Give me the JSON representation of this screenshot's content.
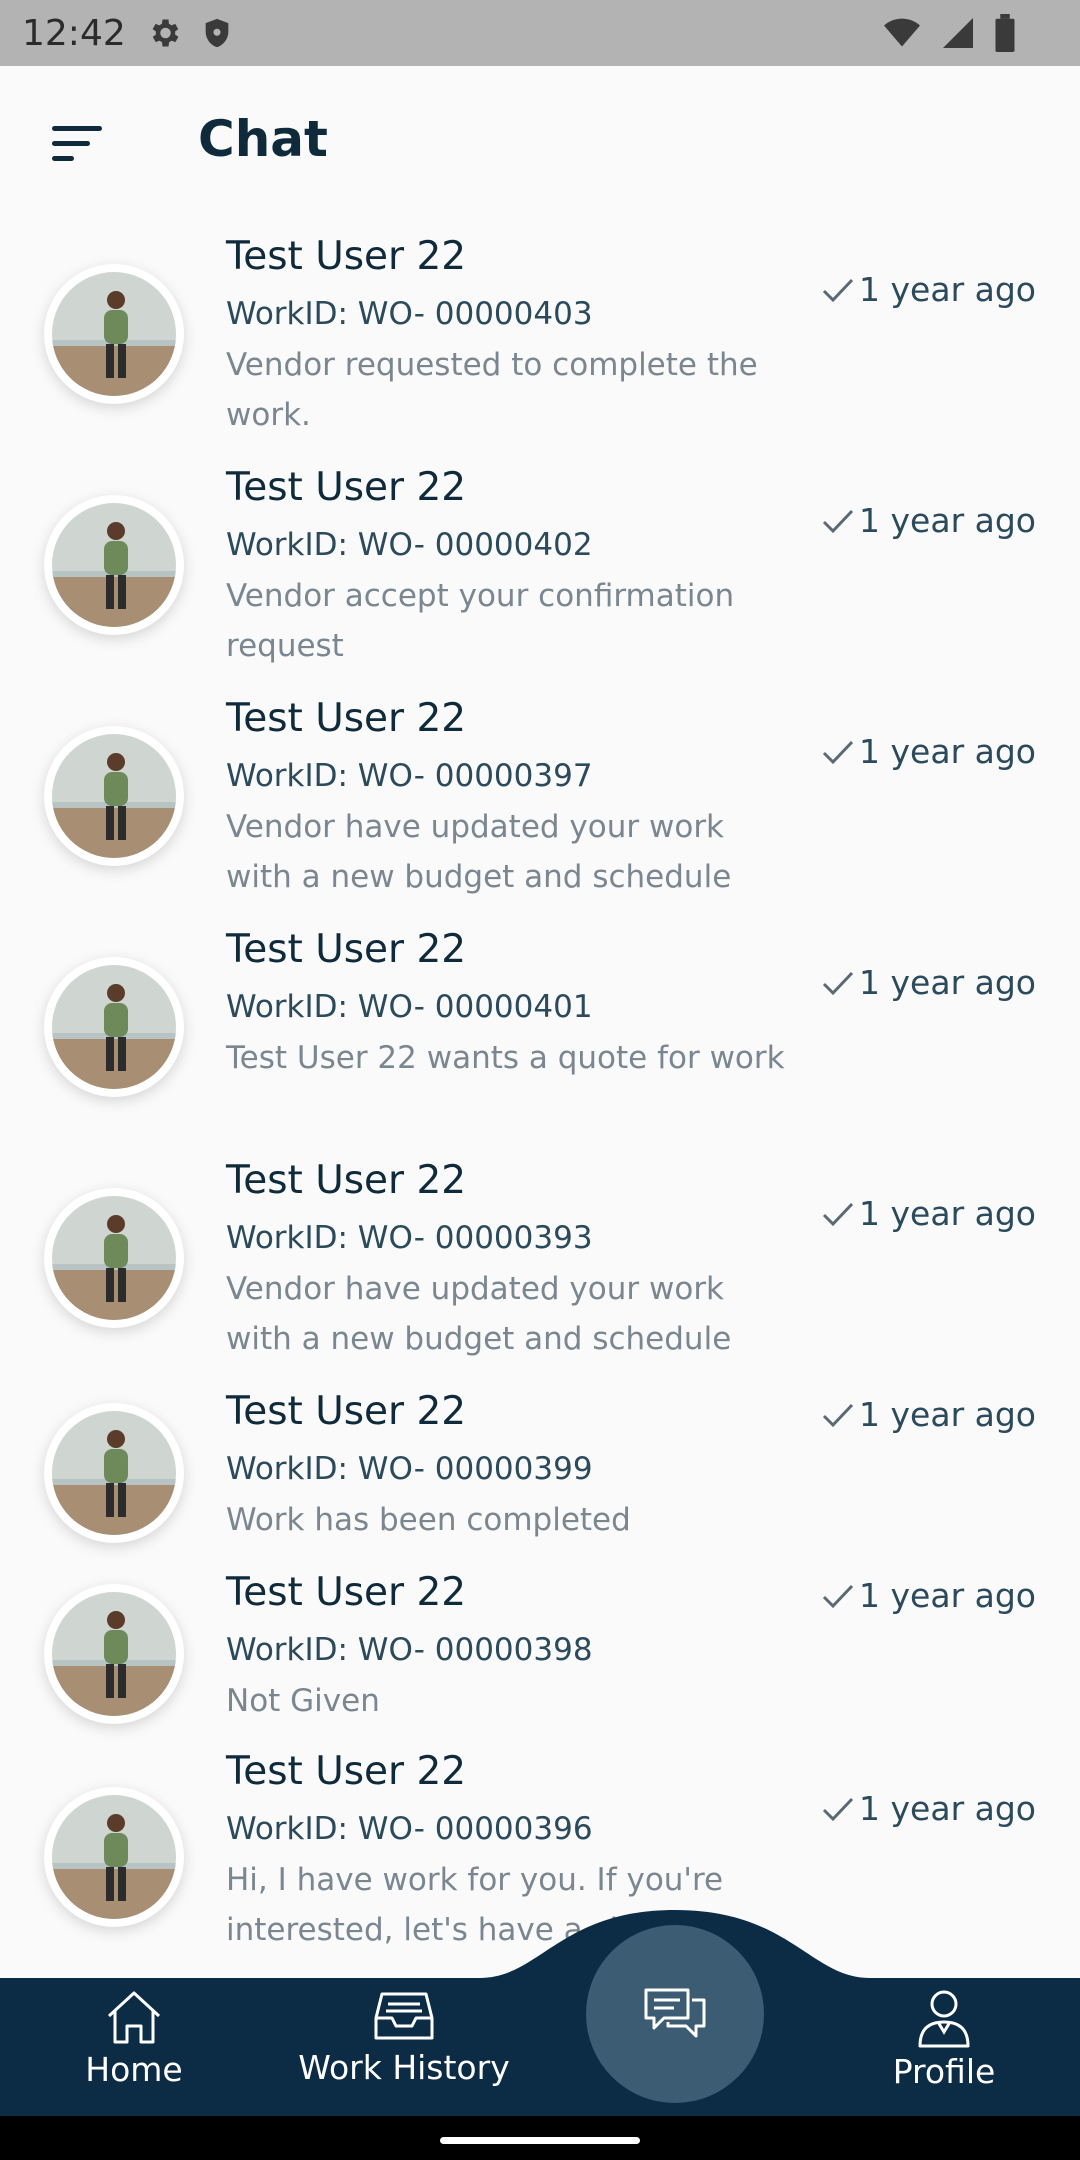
{
  "status_bar": {
    "time": "12:42",
    "icons": [
      "gear-icon",
      "shield-icon",
      "wifi-icon",
      "signal-icon",
      "battery-icon"
    ]
  },
  "header": {
    "title": "Chat",
    "menu_icon": "sort-menu-icon"
  },
  "chats": [
    {
      "name": "Test User 22",
      "workid": "WorkID: WO- 00000403",
      "message": "Vendor requested to complete the work.",
      "time": "1 year ago"
    },
    {
      "name": "Test User 22",
      "workid": "WorkID: WO- 00000402",
      "message": "Vendor accept your confirmation request",
      "time": "1 year ago"
    },
    {
      "name": "Test User 22",
      "workid": "WorkID: WO- 00000397",
      "message": "Vendor have updated your work with a new budget and schedule",
      "time": "1 year ago"
    },
    {
      "name": "Test User 22",
      "workid": "WorkID: WO- 00000401",
      "message": "Test User 22 wants a quote for work",
      "time": "1 year ago"
    },
    {
      "name": "Test User 22",
      "workid": "WorkID: WO- 00000393",
      "message": "Vendor have updated your work with a new budget and schedule",
      "time": "1 year ago"
    },
    {
      "name": "Test User 22",
      "workid": "WorkID: WO- 00000399",
      "message": "Work has been completed",
      "time": "1 year ago"
    },
    {
      "name": "Test User 22",
      "workid": "WorkID: WO- 00000398",
      "message": "Not Given",
      "time": "1 year ago"
    },
    {
      "name": "Test User 22",
      "workid": "WorkID: WO- 00000396",
      "message": "Hi, I have work for you. If you're interested, let's have a chat",
      "time": "1 year ago"
    }
  ],
  "bottom_nav": {
    "home": "Home",
    "work_history": "Work History",
    "chat_icon": "chat-bubbles-icon",
    "profile": "Profile"
  },
  "colors": {
    "nav_background": "#0c2c46",
    "nav_active_circle": "#3b5c72",
    "title_text": "#0f2a3a",
    "message_text": "#7a8690"
  }
}
